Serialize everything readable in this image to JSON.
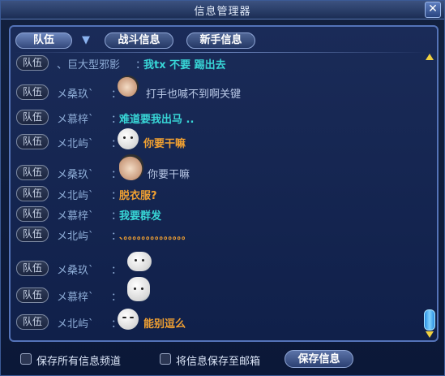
{
  "window": {
    "title": "信息管理器",
    "close_label": "✕"
  },
  "tabs": [
    {
      "label": "队伍"
    },
    {
      "label": "战斗信息"
    },
    {
      "label": "新手信息"
    }
  ],
  "dropdown_arrow": "▼",
  "messages": [
    {
      "channel": "队伍",
      "sender": "、巨大型邪影",
      "text": "我tx 不要 踢出去",
      "style": "cyan",
      "emoticon": ""
    },
    {
      "channel": "队伍",
      "sender": "メ桑玖`",
      "text": "打手也喊不到啊关键",
      "style": "plain",
      "emoticon": "glasses-face-emoticon"
    },
    {
      "channel": "队伍",
      "sender": "メ慕梓`",
      "text": "难道要我出马 ..",
      "style": "cyan",
      "emoticon": ""
    },
    {
      "channel": "队伍",
      "sender": "メ北屿`",
      "text": "你要干嘛",
      "style": "orange",
      "emoticon": "face-emoticon"
    },
    {
      "channel": "队伍",
      "sender": "メ桑玖`",
      "text": "你要干嘛",
      "style": "plain",
      "emoticon": "hooded-face-emoticon"
    },
    {
      "channel": "队伍",
      "sender": "メ北屿`",
      "text": "脱衣服?",
      "style": "orange",
      "emoticon": ""
    },
    {
      "channel": "队伍",
      "sender": "メ慕梓`",
      "text": "我要群发",
      "style": "cyan",
      "emoticon": ""
    },
    {
      "channel": "队伍",
      "sender": "メ北屿`",
      "text": "、。。。。。。。。。。。。。。",
      "style": "orange",
      "emoticon": ""
    },
    {
      "channel": "队伍",
      "sender": "メ桑玖`",
      "text": "",
      "style": "plain",
      "emoticon": "blob-emoticon"
    },
    {
      "channel": "队伍",
      "sender": "メ慕梓`",
      "text": "",
      "style": "plain",
      "emoticon": "bunny-face-emoticon"
    },
    {
      "channel": "队伍",
      "sender": "メ北屿`",
      "text": "能别逗么",
      "style": "orange",
      "emoticon": "grumpy-face-emoticon"
    }
  ],
  "footer": {
    "save_all_label": "保存所有信息频道",
    "save_mail_label": "将信息保存至邮箱",
    "save_button": "保存信息"
  }
}
